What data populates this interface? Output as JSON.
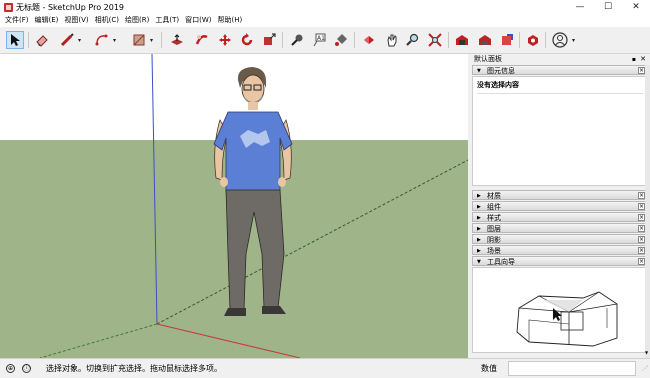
{
  "window": {
    "title": "无标题 - SketchUp Pro 2019",
    "minimize": "—",
    "maximize": "☐",
    "close": "✕"
  },
  "menu": [
    "文件(F)",
    "编辑(E)",
    "视图(V)",
    "相机(C)",
    "绘图(R)",
    "工具(T)",
    "窗口(W)",
    "帮助(H)"
  ],
  "toolbar": {
    "icons": [
      "select-icon",
      "eraser-icon",
      "line-icon",
      "arc-icon",
      "shape-icon",
      "push-pull-icon",
      "follow-me-icon",
      "move-icon",
      "rotate-icon",
      "scale-icon",
      "tape-measure-icon",
      "text-icon",
      "paint-bucket-icon",
      "orbit-icon",
      "pan-icon",
      "zoom-icon",
      "zoom-extents-icon",
      "warehouse-icon",
      "extension-warehouse-icon",
      "send-to-layout-icon",
      "extension-manager-icon",
      "account-icon"
    ],
    "dropdown_glyph": "▾"
  },
  "tray": {
    "title": "默认面板",
    "pin_glyph": "▪",
    "close_glyph": "✕",
    "entity_info": {
      "label": "图元信息",
      "selection": "没有选择内容"
    },
    "sections": [
      "材质",
      "组件",
      "样式",
      "图层",
      "阴影",
      "场景"
    ],
    "instructor": {
      "label": "工具向导"
    },
    "expanded_arrow": "▼",
    "collapsed_arrow": "▶",
    "box_close": "×"
  },
  "status": {
    "geo_icon": "⊕",
    "info_icon": "ⓘ",
    "message": "选择对象。切换到扩充选择。拖动鼠标选择多项。",
    "vcb_label": "数值",
    "vcb_value": ""
  },
  "colors": {
    "sky": "#ffffff",
    "ground": "#a0b48a",
    "axis_red": "#c43a3a",
    "axis_green": "#3e7a3e",
    "axis_blue": "#3b4fc9"
  }
}
